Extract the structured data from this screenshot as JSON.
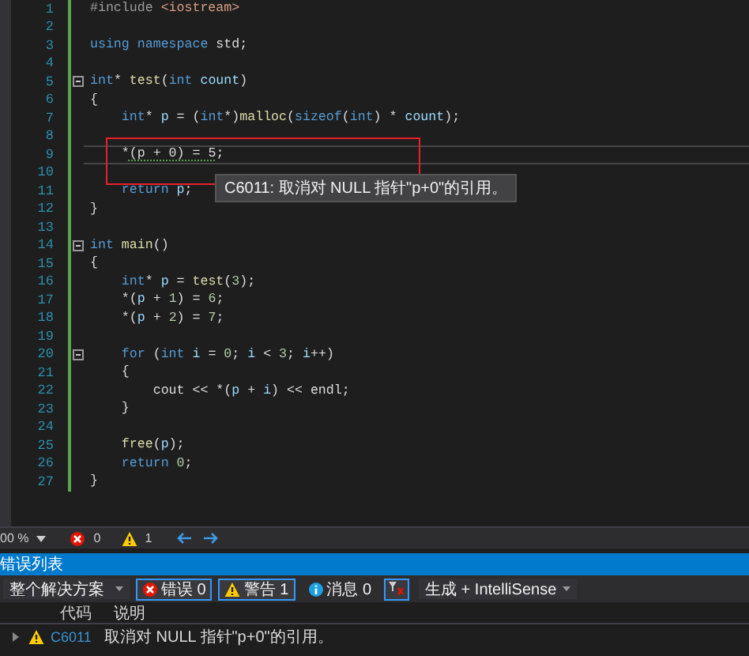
{
  "editor": {
    "lines": [
      {
        "number": "1",
        "fold": false,
        "current": false,
        "tokens": [
          {
            "kind": "pre",
            "text": "#include "
          },
          {
            "kind": "str",
            "text": "<iostream>"
          }
        ]
      },
      {
        "number": "2",
        "fold": false,
        "current": false
      },
      {
        "number": "3",
        "fold": false,
        "current": false,
        "tokens": [
          {
            "kind": "kw",
            "text": "using"
          },
          {
            "kind": "kw",
            "text": " namespace"
          },
          {
            "kind": "plain",
            "text": " std;"
          }
        ]
      },
      {
        "number": "4",
        "fold": false,
        "current": false
      },
      {
        "number": "5",
        "fold": true,
        "current": false,
        "tokens": [
          {
            "kind": "kw",
            "text": "int"
          },
          {
            "kind": "plain",
            "text": "* "
          },
          {
            "kind": "fn",
            "text": "test"
          },
          {
            "kind": "plain",
            "text": "("
          },
          {
            "kind": "kw",
            "text": "int"
          },
          {
            "kind": "var",
            "text": " count"
          },
          {
            "kind": "plain",
            "text": ")"
          }
        ]
      },
      {
        "number": "6",
        "fold": false,
        "current": false,
        "tokens": [
          {
            "kind": "plain",
            "text": "{"
          }
        ]
      },
      {
        "number": "7",
        "fold": false,
        "current": false,
        "tokens": [
          {
            "kind": "kw",
            "text": "    int"
          },
          {
            "kind": "plain",
            "text": "* "
          },
          {
            "kind": "var",
            "text": "p"
          },
          {
            "kind": "plain",
            "text": " = ("
          },
          {
            "kind": "kw",
            "text": "int"
          },
          {
            "kind": "plain",
            "text": "*)"
          },
          {
            "kind": "fn",
            "text": "malloc"
          },
          {
            "kind": "plain",
            "text": "("
          },
          {
            "kind": "kw",
            "text": "sizeof"
          },
          {
            "kind": "plain",
            "text": "("
          },
          {
            "kind": "kw",
            "text": "int"
          },
          {
            "kind": "plain",
            "text": ") * "
          },
          {
            "kind": "var",
            "text": "count"
          },
          {
            "kind": "plain",
            "text": ");"
          }
        ]
      },
      {
        "number": "8",
        "fold": false,
        "current": false
      },
      {
        "number": "9",
        "fold": false,
        "current": true,
        "tokens": [
          {
            "kind": "plain",
            "text": "    *"
          },
          {
            "kind": "plain",
            "text": "(p + 0) = 5",
            "warning": true
          },
          {
            "kind": "plain",
            "text": ";"
          }
        ]
      },
      {
        "number": "10",
        "fold": false,
        "current": false
      },
      {
        "number": "11",
        "fold": false,
        "current": false,
        "tokens": [
          {
            "kind": "kw",
            "text": "    return"
          },
          {
            "kind": "var",
            "text": " p"
          },
          {
            "kind": "plain",
            "text": ";"
          }
        ]
      },
      {
        "number": "12",
        "fold": false,
        "current": false,
        "tokens": [
          {
            "kind": "plain",
            "text": "}"
          }
        ]
      },
      {
        "number": "13",
        "fold": false,
        "current": false
      },
      {
        "number": "14",
        "fold": true,
        "current": false,
        "tokens": [
          {
            "kind": "kw",
            "text": "int"
          },
          {
            "kind": "fn",
            "text": " main"
          },
          {
            "kind": "plain",
            "text": "()"
          }
        ]
      },
      {
        "number": "15",
        "fold": false,
        "current": false,
        "tokens": [
          {
            "kind": "plain",
            "text": "{"
          }
        ]
      },
      {
        "number": "16",
        "fold": false,
        "current": false,
        "tokens": [
          {
            "kind": "kw",
            "text": "    int"
          },
          {
            "kind": "plain",
            "text": "* "
          },
          {
            "kind": "var",
            "text": "p"
          },
          {
            "kind": "plain",
            "text": " = "
          },
          {
            "kind": "fn",
            "text": "test"
          },
          {
            "kind": "plain",
            "text": "("
          },
          {
            "kind": "num",
            "text": "3"
          },
          {
            "kind": "plain",
            "text": ");"
          }
        ]
      },
      {
        "number": "17",
        "fold": false,
        "current": false,
        "tokens": [
          {
            "kind": "plain",
            "text": "    *("
          },
          {
            "kind": "var",
            "text": "p"
          },
          {
            "kind": "plain",
            "text": " + "
          },
          {
            "kind": "num",
            "text": "1"
          },
          {
            "kind": "plain",
            "text": ") = "
          },
          {
            "kind": "num",
            "text": "6"
          },
          {
            "kind": "plain",
            "text": ";"
          }
        ]
      },
      {
        "number": "18",
        "fold": false,
        "current": false,
        "tokens": [
          {
            "kind": "plain",
            "text": "    *("
          },
          {
            "kind": "var",
            "text": "p"
          },
          {
            "kind": "plain",
            "text": " + "
          },
          {
            "kind": "num",
            "text": "2"
          },
          {
            "kind": "plain",
            "text": ") = "
          },
          {
            "kind": "num",
            "text": "7"
          },
          {
            "kind": "plain",
            "text": ";"
          }
        ]
      },
      {
        "number": "19",
        "fold": false,
        "current": false
      },
      {
        "number": "20",
        "fold": true,
        "current": false,
        "tokens": [
          {
            "kind": "kw",
            "text": "    for"
          },
          {
            "kind": "plain",
            "text": " ("
          },
          {
            "kind": "kw",
            "text": "int"
          },
          {
            "kind": "var",
            "text": " i"
          },
          {
            "kind": "plain",
            "text": " = "
          },
          {
            "kind": "num",
            "text": "0"
          },
          {
            "kind": "plain",
            "text": "; "
          },
          {
            "kind": "var",
            "text": "i"
          },
          {
            "kind": "plain",
            "text": " < "
          },
          {
            "kind": "num",
            "text": "3"
          },
          {
            "kind": "plain",
            "text": "; "
          },
          {
            "kind": "var",
            "text": "i"
          },
          {
            "kind": "plain",
            "text": "++)"
          }
        ]
      },
      {
        "number": "21",
        "fold": false,
        "current": false,
        "tokens": [
          {
            "kind": "plain",
            "text": "    {"
          }
        ]
      },
      {
        "number": "22",
        "fold": false,
        "current": false,
        "tokens": [
          {
            "kind": "plain",
            "text": "        cout << *("
          },
          {
            "kind": "var",
            "text": "p"
          },
          {
            "kind": "plain",
            "text": " + "
          },
          {
            "kind": "var",
            "text": "i"
          },
          {
            "kind": "plain",
            "text": ") << endl;"
          }
        ]
      },
      {
        "number": "23",
        "fold": false,
        "current": false,
        "tokens": [
          {
            "kind": "plain",
            "text": "    }"
          }
        ]
      },
      {
        "number": "24",
        "fold": false,
        "current": false
      },
      {
        "number": "25",
        "fold": false,
        "current": false,
        "tokens": [
          {
            "kind": "fn",
            "text": "    free"
          },
          {
            "kind": "plain",
            "text": "("
          },
          {
            "kind": "var",
            "text": "p"
          },
          {
            "kind": "plain",
            "text": ");"
          }
        ]
      },
      {
        "number": "26",
        "fold": false,
        "current": false,
        "tokens": [
          {
            "kind": "kw",
            "text": "    return"
          },
          {
            "kind": "num",
            "text": " 0"
          },
          {
            "kind": "plain",
            "text": ";"
          }
        ]
      },
      {
        "number": "27",
        "fold": false,
        "current": false,
        "tokens": [
          {
            "kind": "plain",
            "text": "}"
          }
        ]
      }
    ],
    "tooltip": {
      "text": "C6011: 取消对 NULL 指针\"p+0\"的引用。"
    }
  },
  "status_bar": {
    "zoom": "00 %",
    "errors": "0",
    "warnings": "1"
  },
  "error_list": {
    "title": "错误列表",
    "scope": "整个解决方案",
    "filters": [
      {
        "kind": "error",
        "label": "错误 0",
        "selected": true
      },
      {
        "kind": "warning",
        "label": "警告 1",
        "selected": true
      },
      {
        "kind": "info",
        "label": "消息 0",
        "selected": false
      }
    ],
    "source": "生成 + IntelliSense",
    "columns": [
      "代码",
      "说明"
    ],
    "rows": [
      {
        "kind": "warning",
        "code": "C6011",
        "description": "取消对 NULL 指针\"p+0\"的引用。"
      }
    ]
  }
}
